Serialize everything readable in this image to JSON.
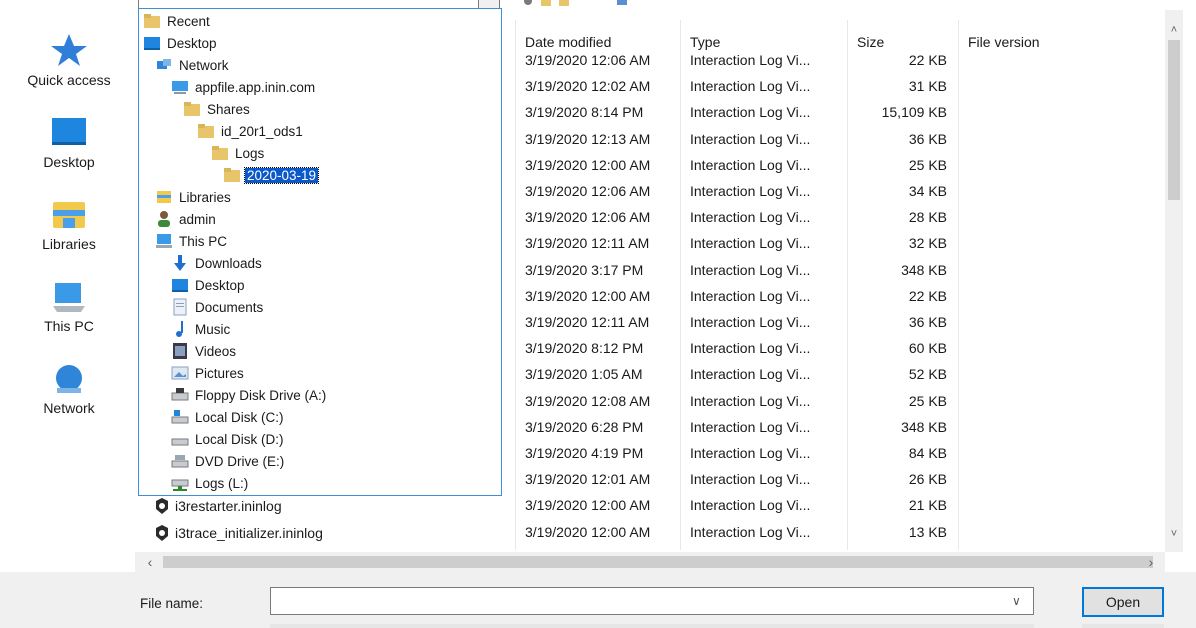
{
  "places": [
    {
      "label": "Quick access",
      "icon": "star-icon"
    },
    {
      "label": "Desktop",
      "icon": "desktop-icon"
    },
    {
      "label": "Libraries",
      "icon": "libraries-icon"
    },
    {
      "label": "This PC",
      "icon": "this-pc-icon"
    },
    {
      "label": "Network",
      "icon": "network-icon"
    }
  ],
  "columns": {
    "date": "Date modified",
    "type": "Type",
    "size": "Size",
    "version": "File version"
  },
  "rows": [
    {
      "name": "",
      "date": "3/19/2020 12:06 AM",
      "type": "Interaction Log Vi...",
      "size": "22 KB"
    },
    {
      "name": "",
      "date": "3/19/2020 12:02 AM",
      "type": "Interaction Log Vi...",
      "size": "31 KB"
    },
    {
      "name": "",
      "date": "3/19/2020 8:14 PM",
      "type": "Interaction Log Vi...",
      "size": "15,109 KB"
    },
    {
      "name": "",
      "date": "3/19/2020 12:13 AM",
      "type": "Interaction Log Vi...",
      "size": "36 KB"
    },
    {
      "name": "",
      "date": "3/19/2020 12:00 AM",
      "type": "Interaction Log Vi...",
      "size": "25 KB"
    },
    {
      "name": "",
      "date": "3/19/2020 12:06 AM",
      "type": "Interaction Log Vi...",
      "size": "34 KB"
    },
    {
      "name": "",
      "date": "3/19/2020 12:06 AM",
      "type": "Interaction Log Vi...",
      "size": "28 KB"
    },
    {
      "name": "",
      "date": "3/19/2020 12:11 AM",
      "type": "Interaction Log Vi...",
      "size": "32 KB"
    },
    {
      "name": "",
      "date": "3/19/2020 3:17 PM",
      "type": "Interaction Log Vi...",
      "size": "348 KB"
    },
    {
      "name": "",
      "date": "3/19/2020 12:00 AM",
      "type": "Interaction Log Vi...",
      "size": "22 KB"
    },
    {
      "name": "",
      "date": "3/19/2020 12:11 AM",
      "type": "Interaction Log Vi...",
      "size": "36 KB"
    },
    {
      "name": "",
      "date": "3/19/2020 8:12 PM",
      "type": "Interaction Log Vi...",
      "size": "60 KB"
    },
    {
      "name": "",
      "date": "3/19/2020 1:05 AM",
      "type": "Interaction Log Vi...",
      "size": "52 KB"
    },
    {
      "name": "",
      "date": "3/19/2020 12:08 AM",
      "type": "Interaction Log Vi...",
      "size": "25 KB"
    },
    {
      "name": "",
      "date": "3/19/2020 6:28 PM",
      "type": "Interaction Log Vi...",
      "size": "348 KB"
    },
    {
      "name": "",
      "date": "3/19/2020 4:19 PM",
      "type": "Interaction Log Vi...",
      "size": "84 KB"
    },
    {
      "name": "",
      "date": "3/19/2020 12:01 AM",
      "type": "Interaction Log Vi...",
      "size": "26 KB"
    },
    {
      "name": "i3restarter.ininlog",
      "date": "3/19/2020 12:00 AM",
      "type": "Interaction Log Vi...",
      "size": "21 KB"
    },
    {
      "name": "i3trace_initializer.ininlog",
      "date": "3/19/2020 12:00 AM",
      "type": "Interaction Log Vi...",
      "size": "13 KB"
    }
  ],
  "tree": [
    {
      "label": "Recent",
      "icon": "folder-icon"
    },
    {
      "label": "Desktop",
      "icon": "desktop-icon"
    },
    {
      "label": "Network",
      "icon": "network-icon"
    },
    {
      "label": "appfile.app.inin.com",
      "icon": "computer-icon"
    },
    {
      "label": "Shares",
      "icon": "folder-icon"
    },
    {
      "label": "id_20r1_ods1",
      "icon": "folder-icon"
    },
    {
      "label": "Logs",
      "icon": "folder-icon"
    },
    {
      "label": "2020-03-19",
      "icon": "folder-icon",
      "selected": true
    },
    {
      "label": "Libraries",
      "icon": "libraries-icon"
    },
    {
      "label": "admin",
      "icon": "user-icon"
    },
    {
      "label": "This PC",
      "icon": "this-pc-icon"
    },
    {
      "label": "Downloads",
      "icon": "download-arrow-icon"
    },
    {
      "label": "Desktop",
      "icon": "desktop-icon"
    },
    {
      "label": "Documents",
      "icon": "documents-icon"
    },
    {
      "label": "Music",
      "icon": "music-note-icon"
    },
    {
      "label": "Videos",
      "icon": "video-icon"
    },
    {
      "label": "Pictures",
      "icon": "pictures-icon"
    },
    {
      "label": "Floppy Disk Drive (A:)",
      "icon": "floppy-drive-icon"
    },
    {
      "label": "Local Disk (C:)",
      "icon": "windows-drive-icon"
    },
    {
      "label": "Local Disk (D:)",
      "icon": "drive-icon"
    },
    {
      "label": "DVD Drive (E:)",
      "icon": "dvd-drive-icon"
    },
    {
      "label": "Logs (L:)",
      "icon": "network-drive-icon"
    }
  ],
  "bottom": {
    "file_name_label": "File name:",
    "file_name_value": "",
    "open_button": "Open"
  },
  "colors": {
    "accent": "#0078d7",
    "selection": "#0a58ca",
    "tree_border": "#3c8fd8",
    "folder": "#e8c56b"
  }
}
